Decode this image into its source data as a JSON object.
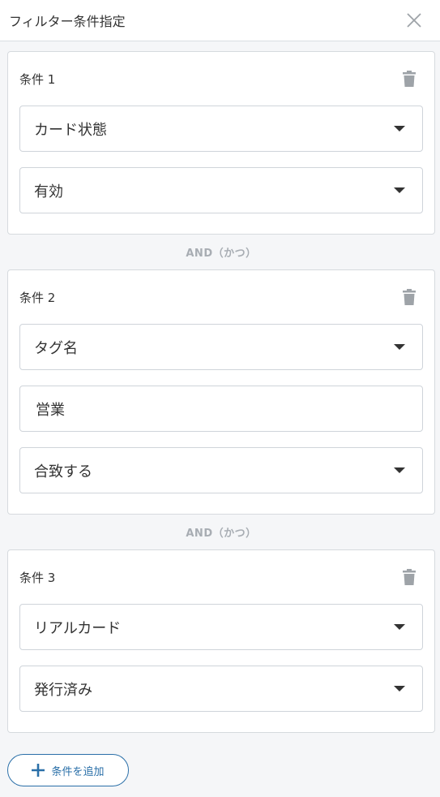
{
  "header": {
    "title": "フィルター条件指定",
    "close_icon": "close-icon"
  },
  "conditions": [
    {
      "title": "条件 1",
      "field": "カード状態",
      "value": "有効"
    },
    {
      "title": "条件 2",
      "field": "タグ名",
      "text_value": "営業",
      "match": "合致する"
    },
    {
      "title": "条件 3",
      "field": "リアルカード",
      "value": "発行済み"
    }
  ],
  "connector_label": "AND（かつ）",
  "add_button": {
    "label": "条件を追加",
    "icon": "plus-icon"
  },
  "colors": {
    "accent": "#2a6fa8",
    "muted_icon": "#9ea3a8",
    "background": "#f5f6f8"
  }
}
